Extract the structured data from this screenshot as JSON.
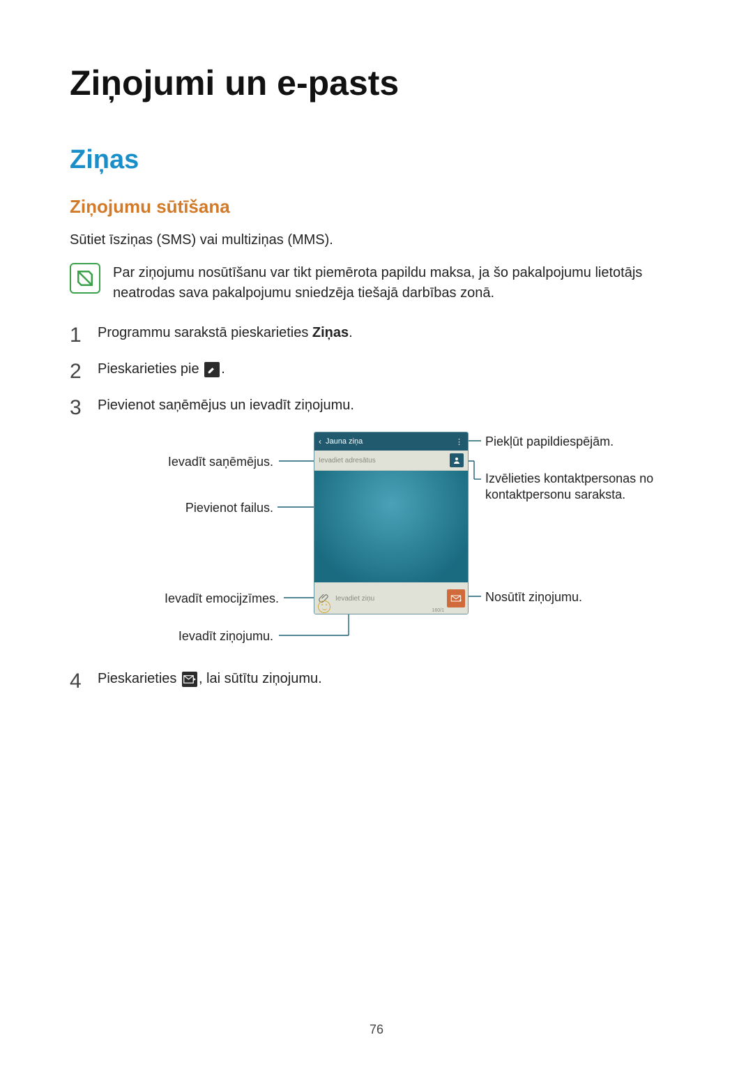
{
  "page": {
    "title": "Ziņojumi un e-pasts",
    "section": "Ziņas",
    "subsection": "Ziņojumu sūtīšana",
    "intro": "Sūtiet īsziņas (SMS) vai multiziņas (MMS).",
    "note": "Par ziņojumu nosūtīšanu var tikt piemērota papildu maksa, ja šo pakalpojumu lietotājs neatrodas sava pakalpojumu sniedzēja tiešajā darbības zonā.",
    "page_number": "76"
  },
  "steps": {
    "s1_pre": "Programmu sarakstā pieskarieties ",
    "s1_bold": "Ziņas",
    "s1_post": ".",
    "s2_pre": "Pieskarieties pie ",
    "s2_post": ".",
    "s3": "Pievienot saņēmējus un ievadīt ziņojumu.",
    "s4_pre": "Pieskarieties ",
    "s4_post": ", lai sūtītu ziņojumu."
  },
  "phone": {
    "header_title": "Jauna ziņa",
    "recipient_placeholder": "Ievadiet adresātus",
    "message_placeholder": "Ievadiet ziņu",
    "counter": "160/1"
  },
  "callouts": {
    "left1": "Ievadīt saņēmējus.",
    "left2": "Pievienot failus.",
    "left3": "Ievadīt emocijzīmes.",
    "left4": "Ievadīt ziņojumu.",
    "right1": "Piekļūt papildiespējām.",
    "right2": "Izvēlieties kontaktpersonas no kontaktpersonu saraksta.",
    "right3": "Nosūtīt ziņojumu."
  }
}
